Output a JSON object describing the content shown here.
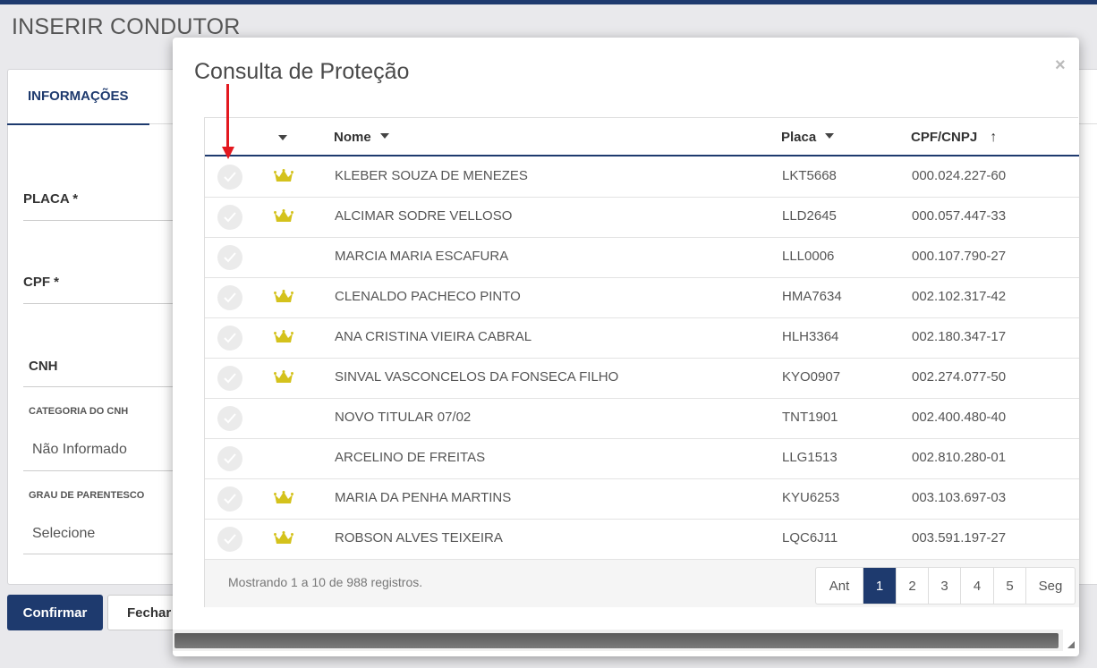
{
  "page": {
    "title": "INSERIR CONDUTOR"
  },
  "background_form": {
    "tab_label": "INFORMAÇÕES",
    "placa_label": "PLACA *",
    "cpf_label": "CPF *",
    "cnh_label": "CNH",
    "categoria_label": "CATEGORIA DO CNH",
    "categoria_value": "Não Informado",
    "grau_label": "GRAU DE PARENTESCO",
    "grau_value": "Selecione",
    "confirm_label": "Confirmar",
    "close_label": "Fechar"
  },
  "modal": {
    "title": "Consulta de Proteção",
    "close_glyph": "×",
    "columns": {
      "nome": "Nome",
      "placa": "Placa",
      "cpf": "CPF/CNPJ",
      "sort_glyph": "↑"
    },
    "rows": [
      {
        "crown": true,
        "nome": "KLEBER SOUZA DE MENEZES",
        "placa": "LKT5668",
        "cpf": "000.024.227-60"
      },
      {
        "crown": true,
        "nome": "ALCIMAR SODRE VELLOSO",
        "placa": "LLD2645",
        "cpf": "000.057.447-33"
      },
      {
        "crown": false,
        "nome": "MARCIA MARIA ESCAFURA",
        "placa": "LLL0006",
        "cpf": "000.107.790-27"
      },
      {
        "crown": true,
        "nome": "CLENALDO PACHECO PINTO",
        "placa": "HMA7634",
        "cpf": "002.102.317-42"
      },
      {
        "crown": true,
        "nome": "ANA CRISTINA VIEIRA CABRAL",
        "placa": "HLH3364",
        "cpf": "002.180.347-17"
      },
      {
        "crown": true,
        "nome": "SINVAL VASCONCELOS DA FONSECA FILHO",
        "placa": "KYO0907",
        "cpf": "002.274.077-50"
      },
      {
        "crown": false,
        "nome": "NOVO TITULAR 07/02",
        "placa": "TNT1901",
        "cpf": "002.400.480-40"
      },
      {
        "crown": false,
        "nome": "ARCELINO DE FREITAS",
        "placa": "LLG1513",
        "cpf": "002.810.280-01"
      },
      {
        "crown": true,
        "nome": "MARIA DA PENHA MARTINS",
        "placa": "KYU6253",
        "cpf": "003.103.697-03"
      },
      {
        "crown": true,
        "nome": "ROBSON ALVES TEIXEIRA",
        "placa": "LQC6J11",
        "cpf": "003.591.197-27"
      }
    ],
    "footer_info": "Mostrando 1 a 10 de 988 registros.",
    "pagination": {
      "prev": "Ant",
      "pages": [
        "1",
        "2",
        "3",
        "4",
        "5"
      ],
      "active_page": "1",
      "next": "Seg"
    }
  },
  "colors": {
    "primary": "#1e3a6e",
    "crown": "#d4c21c",
    "annotation_arrow": "#e3181f"
  },
  "icons": {
    "row_select": "check-circle-icon",
    "row_badge": "crown-icon",
    "annotation": "red-arrow-icon"
  }
}
